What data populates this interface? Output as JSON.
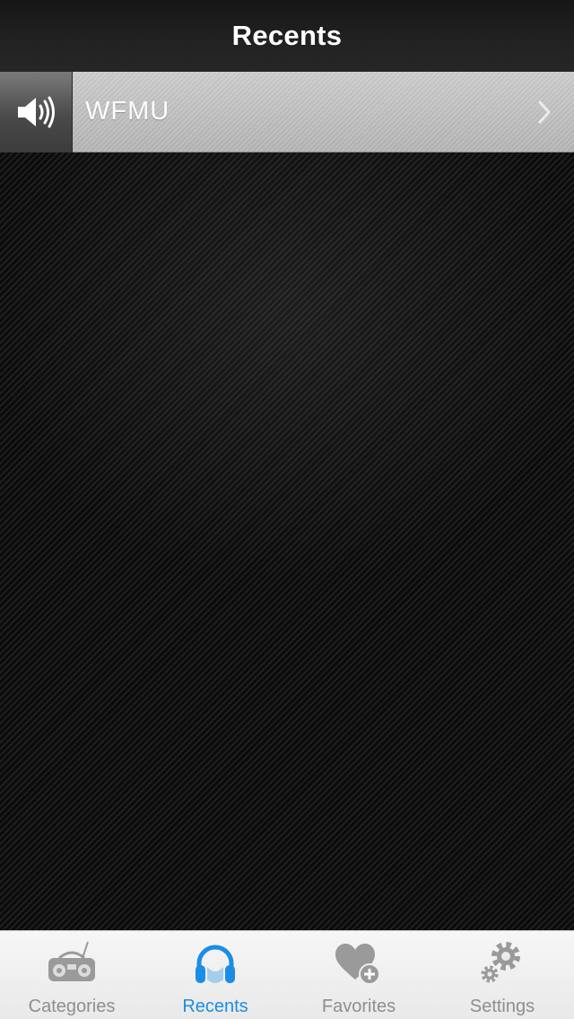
{
  "nav": {
    "title": "Recents"
  },
  "recents": [
    {
      "station": "WFMU",
      "status_icon": "speaker-playing-icon"
    }
  ],
  "tabs": [
    {
      "label": "Categories",
      "icon": "boombox-icon",
      "active": false
    },
    {
      "label": "Recents",
      "icon": "headphones-icon",
      "active": true
    },
    {
      "label": "Favorites",
      "icon": "heart-plus-icon",
      "active": false
    },
    {
      "label": "Settings",
      "icon": "gears-icon",
      "active": false
    }
  ],
  "colors": {
    "accent": "#1a8ee6",
    "inactive_tab": "#8e8e8e",
    "nav_bar": "#1e1e1e",
    "row_background": "#c4c4c4"
  }
}
